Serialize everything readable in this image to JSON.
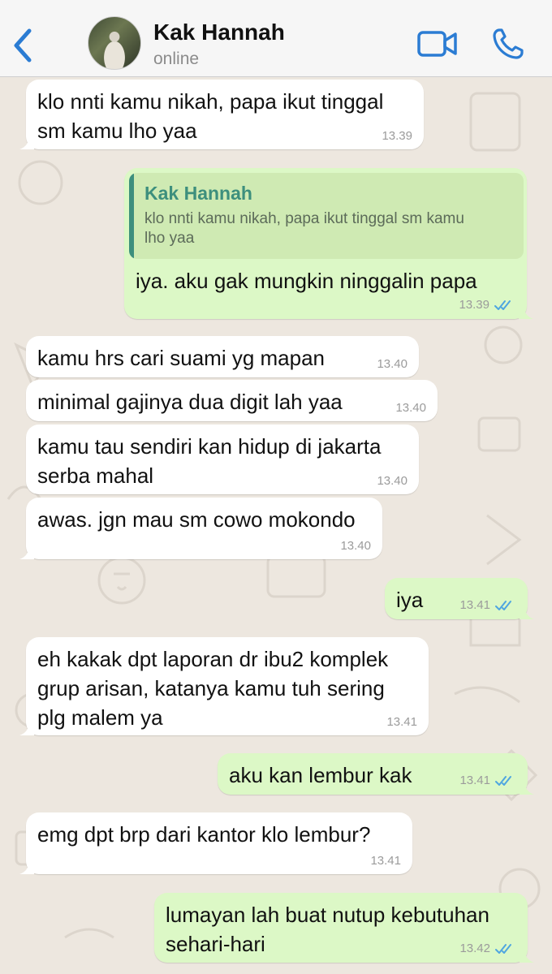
{
  "header": {
    "back_icon": "chevron-left-icon",
    "contact_name": "Kak Hannah",
    "status": "online",
    "video_icon": "video-camera-icon",
    "call_icon": "phone-icon",
    "accent_color": "#2b7cd3"
  },
  "messages": [
    {
      "direction": "in",
      "lines": [
        "klo nnti kamu nikah, papa ikut tinggal",
        "sm kamu lho yaa"
      ],
      "time": "13.39"
    },
    {
      "direction": "out",
      "reply_to": {
        "name": "Kak Hannah",
        "lines": [
          "klo nnti kamu nikah, papa ikut tinggal sm kamu",
          "lho yaa"
        ]
      },
      "lines": [
        "iya. aku gak mungkin ninggalin papa"
      ],
      "time": "13.39",
      "read": true
    },
    {
      "direction": "in",
      "lines": [
        "kamu hrs cari suami yg mapan"
      ],
      "time": "13.40"
    },
    {
      "direction": "in",
      "lines": [
        "minimal gajinya dua digit lah yaa"
      ],
      "time": "13.40"
    },
    {
      "direction": "in",
      "lines": [
        "kamu tau sendiri kan hidup di jakarta",
        "serba mahal"
      ],
      "time": "13.40"
    },
    {
      "direction": "in",
      "lines": [
        "awas. jgn mau sm cowo mokondo"
      ],
      "time": "13.40"
    },
    {
      "direction": "out",
      "lines": [
        "iya"
      ],
      "time": "13.41",
      "read": true
    },
    {
      "direction": "in",
      "lines": [
        "eh kakak dpt laporan dr ibu2 komplek",
        "grup arisan, katanya kamu tuh sering",
        "plg malem ya"
      ],
      "time": "13.41"
    },
    {
      "direction": "out",
      "lines": [
        "aku kan lembur kak"
      ],
      "time": "13.41",
      "read": true
    },
    {
      "direction": "in",
      "lines": [
        "emg dpt brp dari kantor klo lembur?"
      ],
      "time": "13.41"
    },
    {
      "direction": "out",
      "lines": [
        "lumayan lah buat nutup kebutuhan",
        "sehari-hari"
      ],
      "time": "13.42",
      "read": true
    }
  ],
  "colors": {
    "incoming": "#ffffff",
    "outgoing": "#dcf8c6",
    "read_ticks": "#4fa6e0",
    "quote_accent": "#3d8f7d"
  }
}
